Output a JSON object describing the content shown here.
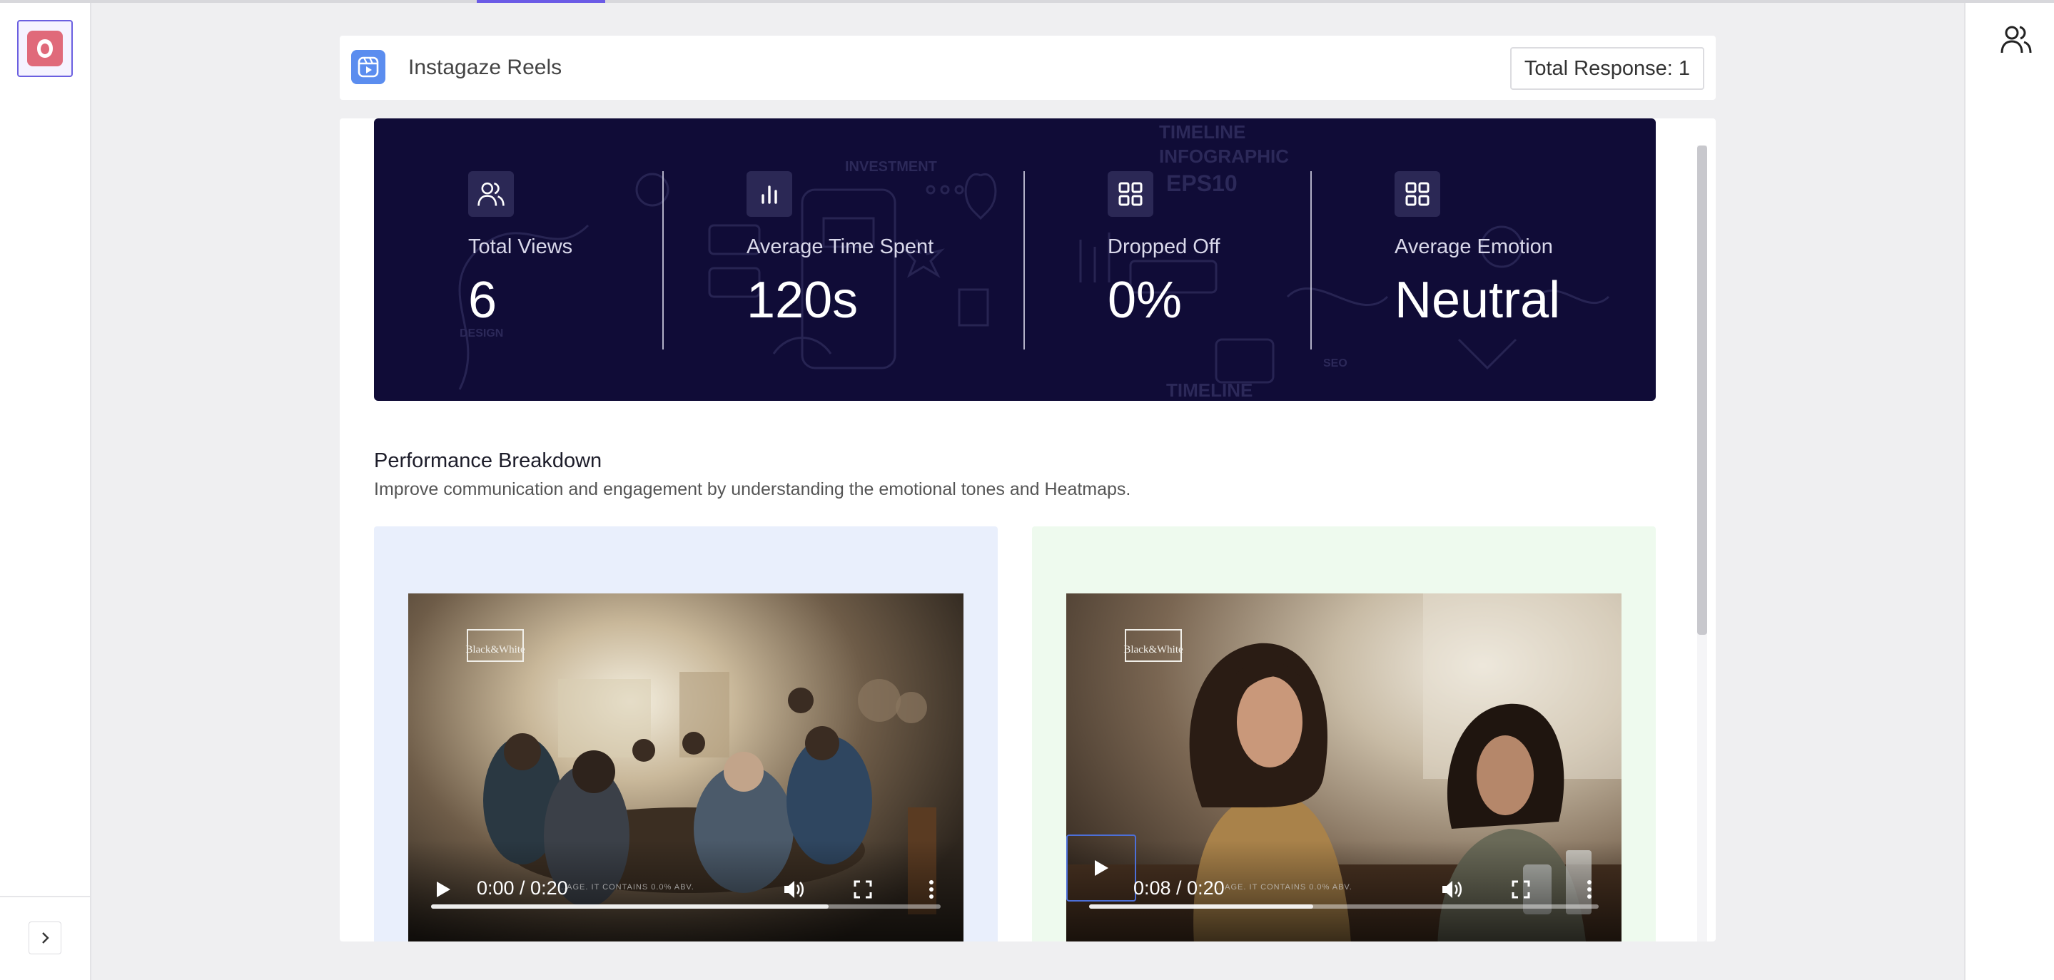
{
  "header": {
    "title": "Instagaze Reels",
    "total_response": "Total Response: 1"
  },
  "icons": {
    "app_logo": "app-logo-icon",
    "expand": "chevron-right-icon",
    "account": "users-icon",
    "reels": "reels-icon"
  },
  "stats": [
    {
      "label": "Total Views",
      "value": "6",
      "icon": "users-icon"
    },
    {
      "label": "Average Time Spent",
      "value": "120s",
      "icon": "bar-chart-icon"
    },
    {
      "label": "Dropped Off",
      "value": "0%",
      "icon": "grid-icon"
    },
    {
      "label": "Average Emotion",
      "value": "Neutral",
      "icon": "grid-icon"
    }
  ],
  "performance": {
    "title": "Performance Breakdown",
    "subtitle": "Improve communication and engagement by understanding the emotional tones and Heatmaps."
  },
  "videos": [
    {
      "time": "0:00 / 0:20",
      "buffered": 0.78,
      "background": "#e9effc",
      "brand": "Black&White",
      "fine_print": "...AGE. IT CONTAINS 0.0% ABV."
    },
    {
      "time": "0:08 / 0:20",
      "buffered": 0.44,
      "background": "#eefaee",
      "brand": "Black&White",
      "fine_print": "...AGE. IT CONTAINS 0.0% ABV."
    }
  ],
  "colors": {
    "accent": "#6b5be6",
    "banner": "#100c37",
    "reels_blue": "#5b8def",
    "logo_red": "#e06a7a"
  }
}
